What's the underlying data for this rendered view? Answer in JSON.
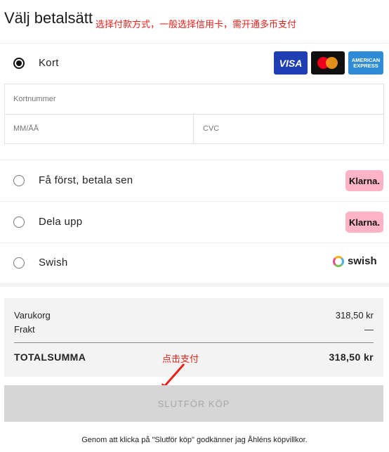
{
  "header": {
    "title": "Välj betalsätt"
  },
  "annotations": {
    "top_note": "选择付款方式，一般选择信用卡，需开通多币支付",
    "pay_note": "点击支付"
  },
  "payment_options": {
    "card": {
      "label": "Kort",
      "selected": true,
      "logos": [
        "VISA",
        "Mastercard",
        "AMERICAN EXPRESS"
      ]
    },
    "card_fields": {
      "number_placeholder": "Kortnummer",
      "expiry_placeholder": "MM/ÅÅ",
      "cvc_placeholder": "CVC"
    },
    "klarna_later": {
      "label": "Få först, betala sen",
      "badge": "Klarna."
    },
    "klarna_split": {
      "label": "Dela upp",
      "badge": "Klarna."
    },
    "swish": {
      "label": "Swish",
      "badge": "swish"
    }
  },
  "summary": {
    "cart_label": "Varukorg",
    "cart_value": "318,50 kr",
    "shipping_label": "Frakt",
    "shipping_value": "—",
    "total_label": "TOTALSUMMA",
    "total_value": "318,50 kr"
  },
  "submit": {
    "label": "SLUTFÖR KÖP",
    "enabled": false
  },
  "terms": "Genom att klicka på \"Slutför köp\" godkänner jag Åhléns köpvillkor.",
  "colors": {
    "annotation": "#e8231a",
    "klarna": "#ffb3c7",
    "visa": "#1d3fb3",
    "amex": "#2f8bd6"
  },
  "amex_lines": [
    "AMERICAN",
    "EXPRESS"
  ]
}
